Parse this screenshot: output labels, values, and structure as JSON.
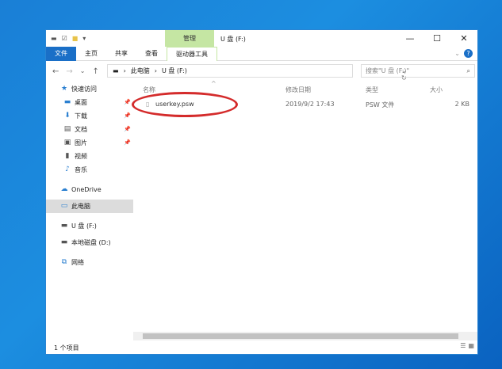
{
  "window": {
    "title": "U 盘 (F:)",
    "manage_label": "管理",
    "minimize": "—",
    "maximize": "☐",
    "close": "✕"
  },
  "ribbon": {
    "tabs": [
      "文件",
      "主页",
      "共享",
      "查看",
      "驱动器工具"
    ],
    "help": "?",
    "collapse": "⌄"
  },
  "nav": {
    "back": "←",
    "forward": "→",
    "recent": "⌄",
    "up": "↑",
    "breadcrumb": [
      "此电脑",
      "U 盘 (F:)"
    ],
    "search_placeholder": "搜索\"U 盘 (F:)\""
  },
  "sidebar": {
    "items": [
      {
        "label": "快速访问",
        "icon": "star-icon",
        "glyph": "★",
        "pinned": false,
        "sub": false
      },
      {
        "label": "桌面",
        "icon": "desktop-icon",
        "glyph": "▬",
        "pinned": true,
        "sub": true
      },
      {
        "label": "下载",
        "icon": "download-icon",
        "glyph": "⬇",
        "pinned": true,
        "sub": true
      },
      {
        "label": "文档",
        "icon": "document-icon",
        "glyph": "▤",
        "pinned": true,
        "sub": true
      },
      {
        "label": "图片",
        "icon": "picture-icon",
        "glyph": "▣",
        "pinned": true,
        "sub": true
      },
      {
        "label": "视频",
        "icon": "video-icon",
        "glyph": "▮",
        "pinned": false,
        "sub": true
      },
      {
        "label": "音乐",
        "icon": "music-icon",
        "glyph": "♪",
        "pinned": false,
        "sub": true
      },
      {
        "label": "OneDrive",
        "icon": "cloud-icon",
        "glyph": "☁",
        "pinned": false,
        "sub": false
      },
      {
        "label": "此电脑",
        "icon": "computer-icon",
        "glyph": "▭",
        "pinned": false,
        "sub": false
      },
      {
        "label": "U 盘 (F:)",
        "icon": "drive-icon",
        "glyph": "▬",
        "pinned": false,
        "sub": false
      },
      {
        "label": "本地磁盘 (D:)",
        "icon": "drive-icon",
        "glyph": "▬",
        "pinned": false,
        "sub": false
      },
      {
        "label": "网络",
        "icon": "network-icon",
        "glyph": "⧉",
        "pinned": false,
        "sub": false
      }
    ]
  },
  "columns": {
    "name": "名称",
    "date": "修改日期",
    "type": "类型",
    "size": "大小"
  },
  "files": [
    {
      "name": "userkey.psw",
      "date": "2019/9/2 17:43",
      "type": "PSW 文件",
      "size": "2 KB"
    }
  ],
  "status": {
    "count": "1 个项目"
  },
  "colors": {
    "accent": "#1a6fc7",
    "manage": "#c5e6a3",
    "highlight": "#d42b2b"
  }
}
